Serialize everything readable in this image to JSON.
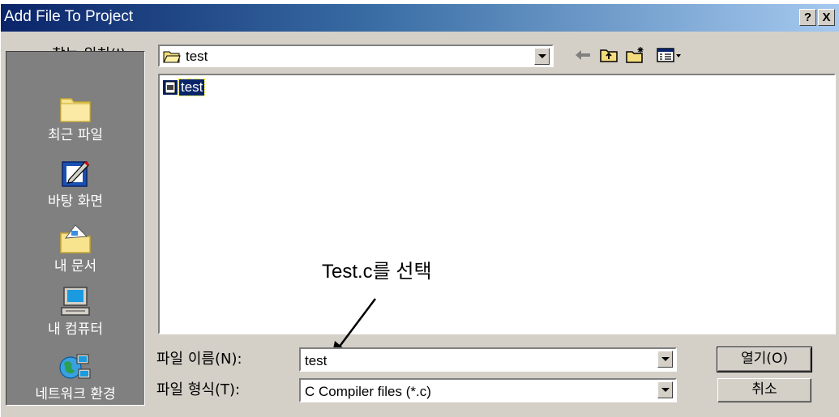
{
  "window": {
    "title": "Add File To Project",
    "help_label": "?",
    "close_label": "X"
  },
  "lookin": {
    "label": "찾는 위치(I):",
    "value": "test"
  },
  "toolbar": {
    "icons": [
      "back-arrow-icon",
      "up-folder-icon",
      "new-folder-icon",
      "view-menu-icon"
    ]
  },
  "places": [
    {
      "label": "최근 파일",
      "icon": "recent-files-folder-icon"
    },
    {
      "label": "바탕 화면",
      "icon": "desktop-icon"
    },
    {
      "label": "내 문서",
      "icon": "my-documents-icon"
    },
    {
      "label": "내 컴퓨터",
      "icon": "my-computer-icon"
    },
    {
      "label": "네트워크 환경",
      "icon": "network-icon"
    }
  ],
  "files": [
    {
      "name": "test",
      "selected": true
    }
  ],
  "filename": {
    "label": "파일 이름(N):",
    "value": "test"
  },
  "filetype": {
    "label": "파일 형식(T):",
    "value": "C Compiler files (*.c)"
  },
  "buttons": {
    "open": "열기(O)",
    "cancel": "취소"
  },
  "annotation": {
    "text": "Test.c를 선택"
  },
  "colors": {
    "title_bar_start": "#0a246a",
    "title_bar_end": "#a6caf0",
    "dialog_face": "#d4d0c8",
    "places_bar": "#808080",
    "selection": "#0a246a"
  }
}
